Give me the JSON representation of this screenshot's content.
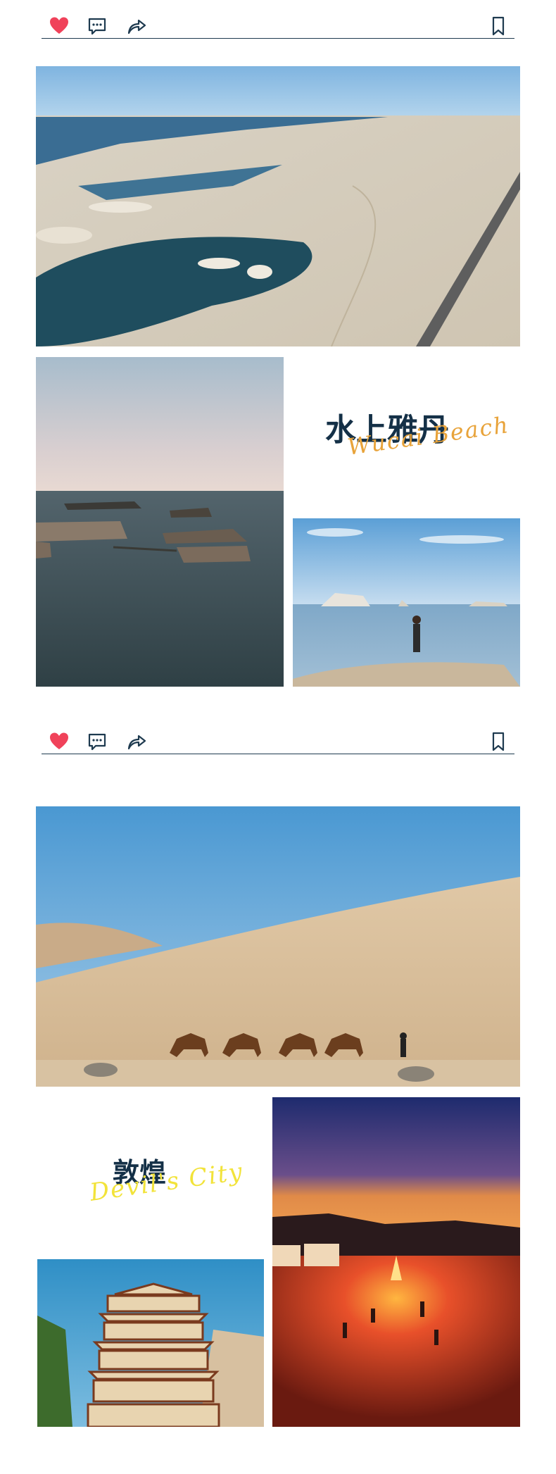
{
  "post_1": {
    "actions": {
      "like": "heart-icon",
      "comment": "comment-icon",
      "share": "share-icon",
      "save": "bookmark-icon"
    },
    "photos": [
      {
        "name": "yardang-aerial-photo",
        "description_icon": "landscape-photo"
      },
      {
        "name": "yardang-lake-sunset-photo",
        "description_icon": "landscape-photo"
      },
      {
        "name": "person-on-shore-photo",
        "description_icon": "landscape-photo"
      }
    ],
    "title_cn": "水上雅丹",
    "title_script": "Wucai Beach",
    "script_color": "#e8a33a"
  },
  "post_2": {
    "actions": {
      "like": "heart-icon",
      "comment": "comment-icon",
      "share": "share-icon",
      "save": "bookmark-icon"
    },
    "photos": [
      {
        "name": "camel-caravan-dunes-photo",
        "description_icon": "landscape-photo"
      },
      {
        "name": "desert-bonfire-camp-photo",
        "description_icon": "landscape-photo"
      },
      {
        "name": "pagoda-temple-photo",
        "description_icon": "landscape-photo"
      }
    ],
    "title_cn": "敦煌",
    "title_script": "Devil's City",
    "script_color": "#f2e33a"
  },
  "colors": {
    "heart": "#f0425a",
    "icon_stroke": "#1e3a4f",
    "divider": "#1e3a4f",
    "title_dark": "#143047"
  }
}
